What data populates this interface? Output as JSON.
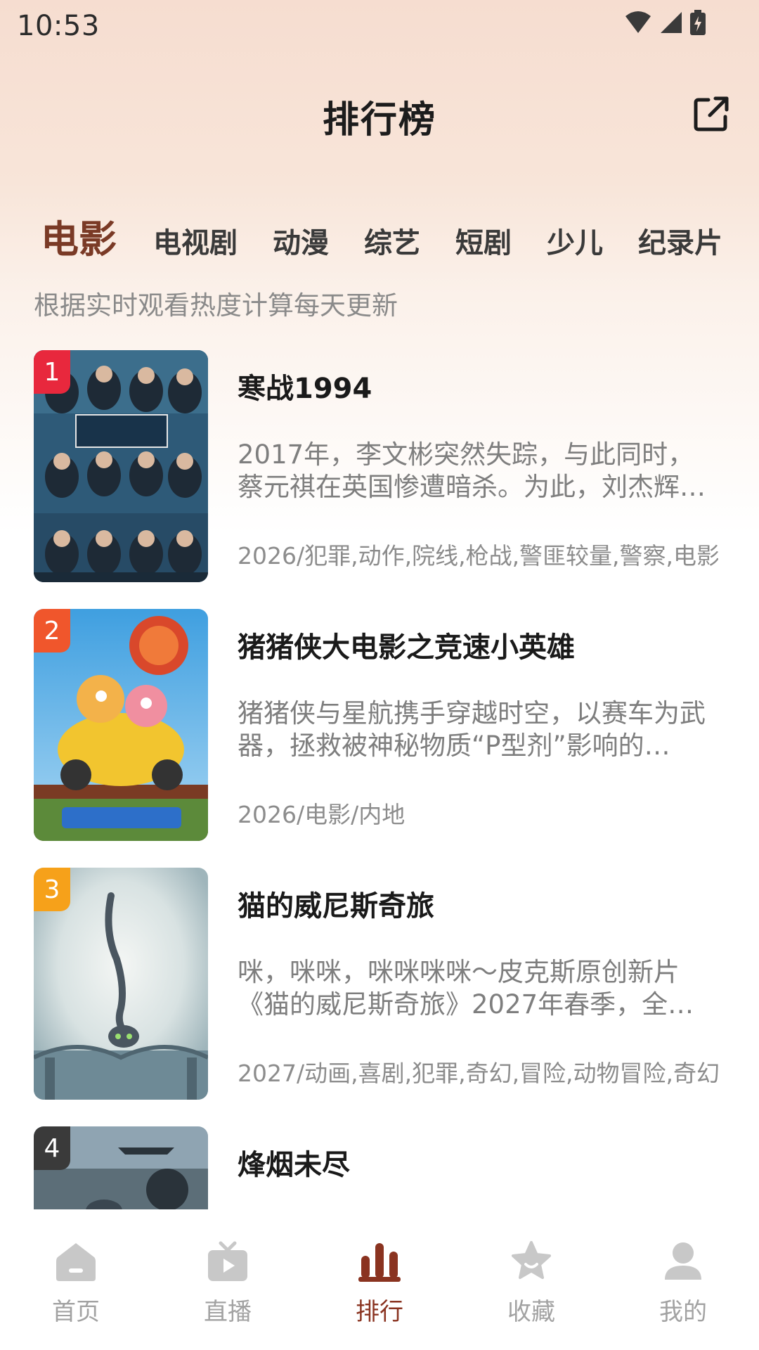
{
  "status_bar": {
    "time": "10:53"
  },
  "header": {
    "title": "排行榜",
    "share_icon": "external-share-icon"
  },
  "tabs": [
    {
      "label": "电影",
      "active": true
    },
    {
      "label": "电视剧",
      "active": false
    },
    {
      "label": "动漫",
      "active": false
    },
    {
      "label": "综艺",
      "active": false
    },
    {
      "label": "短剧",
      "active": false
    },
    {
      "label": "少儿",
      "active": false
    },
    {
      "label": "纪录片",
      "active": false
    }
  ],
  "subtitle": "根据实时观看热度计算每天更新",
  "items": [
    {
      "rank": "1",
      "title": "寒战1994",
      "description": "2017年，李文彬突然失踪，与此同时，蔡元祺在英国惨遭暗杀。为此，刘杰辉…",
      "meta": "2026/犯罪,动作,院线,枪战,警匪较量,警察,电影"
    },
    {
      "rank": "2",
      "title": "猪猪侠大电影之竞速小英雄",
      "description": "猪猪侠与星航携手穿越时空，以赛车为武器，拯救被神秘物质“P型剂”影响的…",
      "meta": "2026/电影/内地"
    },
    {
      "rank": "3",
      "title": "猫的威尼斯奇旅",
      "description": "咪，咪咪，咪咪咪咪～皮克斯原创新片《猫的威尼斯奇旅》2027年春季，全…",
      "meta": "2027/动画,喜剧,犯罪,奇幻,冒险,动物冒险,奇幻"
    },
    {
      "rank": "4",
      "title": "烽烟未尽",
      "description": "",
      "meta": ""
    }
  ],
  "bottom_nav": [
    {
      "label": "首页",
      "icon": "home-icon",
      "active": false
    },
    {
      "label": "直播",
      "icon": "tv-play-icon",
      "active": false
    },
    {
      "label": "排行",
      "icon": "ranking-bars-icon",
      "active": true
    },
    {
      "label": "收藏",
      "icon": "star-icon",
      "active": false
    },
    {
      "label": "我的",
      "icon": "user-icon",
      "active": false
    }
  ],
  "colors": {
    "accent": "#8a3320",
    "active_tab": "#7a3a26",
    "rank1": "#e8283d",
    "rank2": "#f0562c",
    "rank3": "#f6a11a",
    "rank4": "#3a3a3a"
  }
}
